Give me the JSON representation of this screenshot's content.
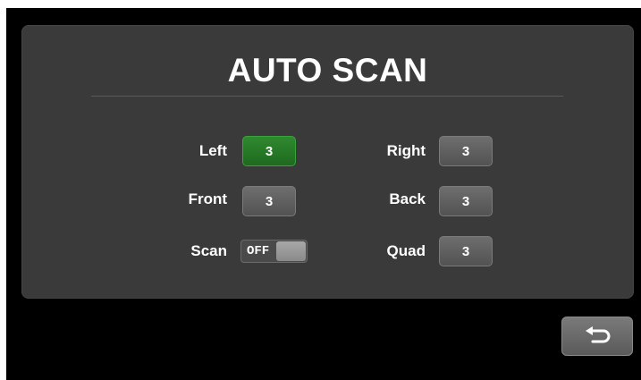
{
  "header": {
    "title": "AUTO SCAN"
  },
  "settings": {
    "left": {
      "label": "Left",
      "value": "3",
      "selected": true
    },
    "front": {
      "label": "Front",
      "value": "3"
    },
    "scan": {
      "label": "Scan",
      "toggle_text": "OFF",
      "state": "off"
    },
    "right": {
      "label": "Right",
      "value": "3"
    },
    "back": {
      "label": "Back",
      "value": "3"
    },
    "quad": {
      "label": "Quad",
      "value": "3"
    }
  },
  "footer": {
    "back_icon": "return-arrow-icon"
  },
  "colors": {
    "selected": "#2f8a2f",
    "panel": "#3a3a3a",
    "background": "#000000"
  }
}
